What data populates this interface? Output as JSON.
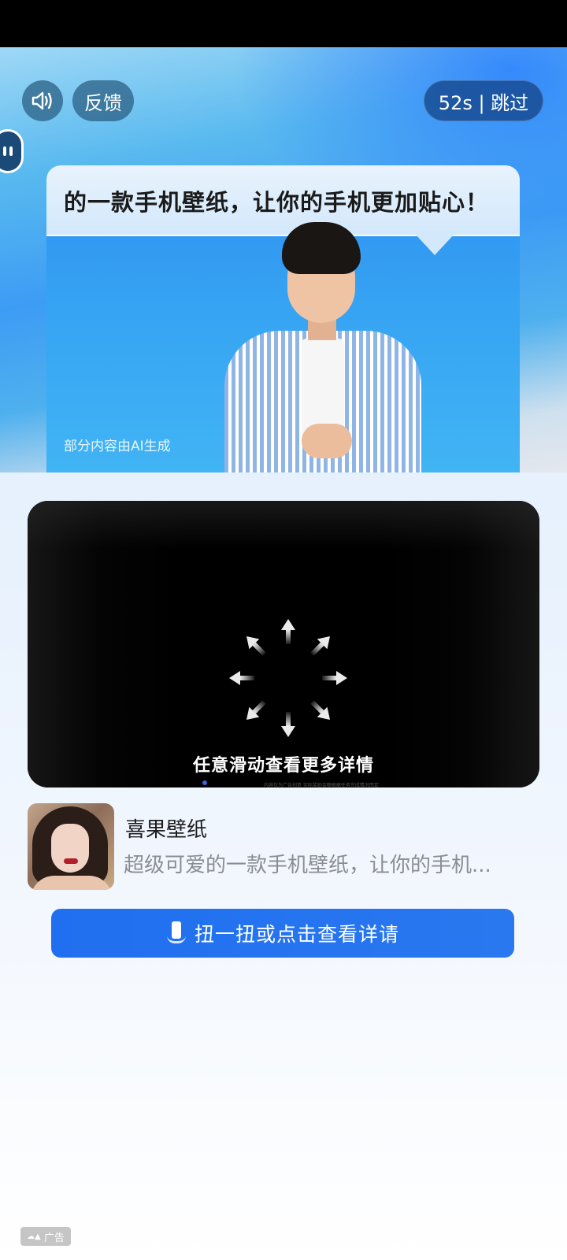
{
  "status_bar": {},
  "hero": {
    "feedback_label": "反馈",
    "skip_label": "52s | 跳过",
    "caption": "的一款手机壁纸，让你的手机更加贴心！",
    "ai_note": "部分内容由AI生成",
    "icons": {
      "sound": "speaker-icon",
      "float": "pause-ball-icon"
    }
  },
  "interaction": {
    "hint": "任意滑动查看更多详情",
    "fine_print": "内容仅为广告创意 实际奖励金额根据任务完成情况而定",
    "icon": "swipe-arrows-icon"
  },
  "app": {
    "name": "喜果壁纸",
    "description": "超级可爱的一款手机壁纸，让你的手机..."
  },
  "cta": {
    "label": "扭一扭或点击查看详请",
    "icon": "phone-shake-icon"
  },
  "ad_badge": {
    "logo": "☁▲",
    "label": "广告"
  },
  "colors": {
    "accent": "#1f6ff0",
    "skip_bg": "#14468c",
    "card_bg": "#000000"
  }
}
